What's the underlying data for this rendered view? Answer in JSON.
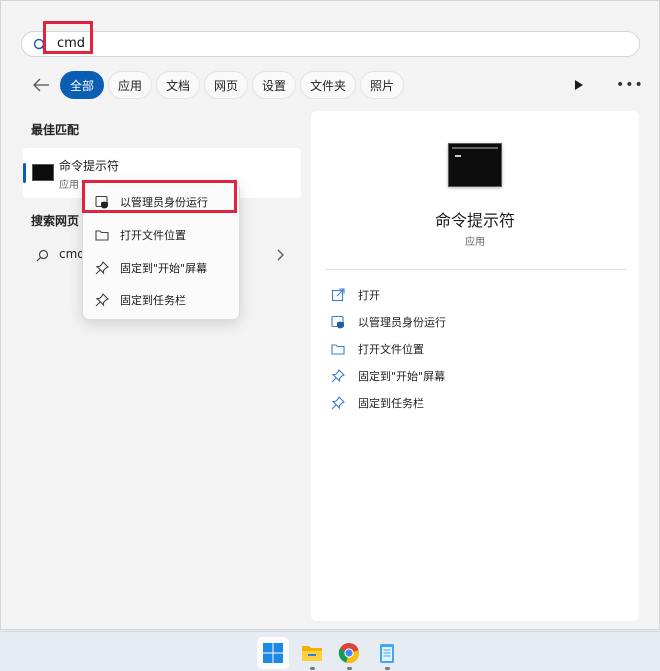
{
  "search": {
    "query": "cmd"
  },
  "filters": {
    "items": [
      {
        "label": "全部",
        "active": true
      },
      {
        "label": "应用"
      },
      {
        "label": "文档"
      },
      {
        "label": "网页"
      },
      {
        "label": "设置"
      },
      {
        "label": "文件夹"
      },
      {
        "label": "照片"
      }
    ],
    "more_label": "•••"
  },
  "best_match": {
    "title": "最佳匹配",
    "name": "命令提示符",
    "type": "应用"
  },
  "web_search": {
    "title": "搜索网页",
    "text": "cmd"
  },
  "context_menu": {
    "items": [
      {
        "label": "以管理员身份运行",
        "icon": "admin-shield-icon"
      },
      {
        "label": "打开文件位置",
        "icon": "folder-icon"
      },
      {
        "label": "固定到\"开始\"屏幕",
        "icon": "pin-icon"
      },
      {
        "label": "固定到任务栏",
        "icon": "pin-icon"
      }
    ]
  },
  "detail": {
    "app_name": "命令提示符",
    "app_type": "应用",
    "actions": [
      {
        "label": "打开",
        "icon": "open-external-icon"
      },
      {
        "label": "以管理员身份运行",
        "icon": "admin-shield-icon"
      },
      {
        "label": "打开文件位置",
        "icon": "folder-icon"
      },
      {
        "label": "固定到\"开始\"屏幕",
        "icon": "pin-icon"
      },
      {
        "label": "固定到任务栏",
        "icon": "pin-icon"
      }
    ]
  },
  "taskbar": {
    "icons": [
      "windows-start-icon",
      "file-explorer-icon",
      "chrome-icon",
      "notepad-icon"
    ]
  },
  "colors": {
    "accent": "#0a5fb4",
    "highlight": "#e0243d",
    "panel_bg": "#f3f3f3"
  }
}
